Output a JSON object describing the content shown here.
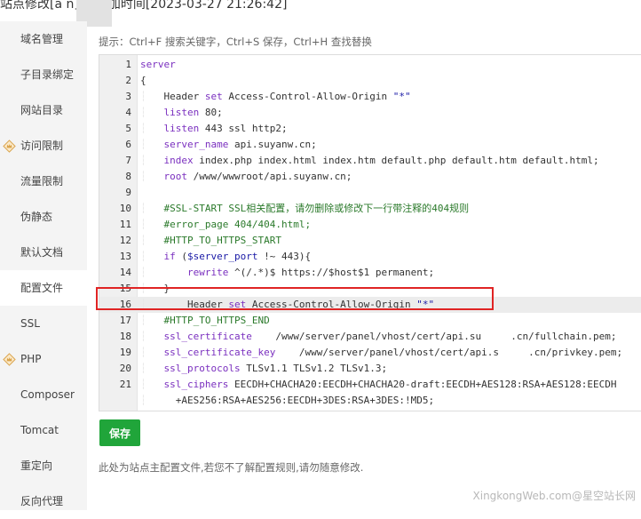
{
  "window": {
    "title": "站点修改[a  n] -- 添加时间[2023-03-27 21:26:42]"
  },
  "sidebar": {
    "items": [
      {
        "label": "域名管理",
        "vip": false,
        "active": false
      },
      {
        "label": "子目录绑定",
        "vip": false,
        "active": false
      },
      {
        "label": "网站目录",
        "vip": false,
        "active": false
      },
      {
        "label": "访问限制",
        "vip": true,
        "active": false
      },
      {
        "label": "流量限制",
        "vip": false,
        "active": false
      },
      {
        "label": "伪静态",
        "vip": false,
        "active": false
      },
      {
        "label": "默认文档",
        "vip": false,
        "active": false
      },
      {
        "label": "配置文件",
        "vip": false,
        "active": true
      },
      {
        "label": "SSL",
        "vip": false,
        "active": false
      },
      {
        "label": "PHP",
        "vip": true,
        "active": false
      },
      {
        "label": "Composer",
        "vip": false,
        "active": false
      },
      {
        "label": "Tomcat",
        "vip": false,
        "active": false
      },
      {
        "label": "重定向",
        "vip": false,
        "active": false
      },
      {
        "label": "反向代理",
        "vip": false,
        "active": false
      }
    ]
  },
  "hint": "提示：Ctrl+F 搜索关键字，Ctrl+S 保存，Ctrl+H 查找替换",
  "editor": {
    "active_line": 16,
    "lines": [
      {
        "n": "1",
        "text": "server"
      },
      {
        "n": "2",
        "text": "{"
      },
      {
        "n": "3",
        "text": "    Header set Access-Control-Allow-Origin \"*\""
      },
      {
        "n": "4",
        "text": "    listen 80;"
      },
      {
        "n": "5",
        "text": "    listen 443 ssl http2;"
      },
      {
        "n": "6",
        "text": "    server_name api.suyanw.cn;"
      },
      {
        "n": "7",
        "text": "    index index.php index.html index.htm default.php default.htm default.html;"
      },
      {
        "n": "8",
        "text": "    root /www/wwwroot/api.suyanw.cn;"
      },
      {
        "n": "9",
        "text": ""
      },
      {
        "n": "10",
        "text": "    #SSL-START SSL相关配置，请勿删除或修改下一行带注释的404规则"
      },
      {
        "n": "11",
        "text": "    #error_page 404/404.html;"
      },
      {
        "n": "12",
        "text": "    #HTTP_TO_HTTPS_START"
      },
      {
        "n": "13",
        "text": "    if ($server_port !~ 443){"
      },
      {
        "n": "14",
        "text": "        rewrite ^(/.*)$ https://$host$1 permanent;"
      },
      {
        "n": "15",
        "text": "    }"
      },
      {
        "n": "16",
        "text": "        Header set Access-Control-Allow-Origin \"*\""
      },
      {
        "n": "17",
        "text": "    #HTTP_TO_HTTPS_END"
      },
      {
        "n": "18",
        "text": "    ssl_certificate    /www/server/panel/vhost/cert/api.su     .cn/fullchain.pem;"
      },
      {
        "n": "19",
        "text": "    ssl_certificate_key    /www/server/panel/vhost/cert/api.s     .cn/privkey.pem;"
      },
      {
        "n": "20",
        "text": "    ssl_protocols TLSv1.1 TLSv1.2 TLSv1.3;"
      },
      {
        "n": "21",
        "text": "    ssl_ciphers EECDH+CHACHA20:EECDH+CHACHA20-draft:EECDH+AES128:RSA+AES128:EECDH"
      },
      {
        "n": "",
        "text": "      +AES256:RSA+AES256:EECDH+3DES:RSA+3DES:!MD5;"
      }
    ]
  },
  "save_button": "保存",
  "note": "此处为站点主配置文件,若您不了解配置规则,请勿随意修改.",
  "watermark": "XingkongWeb.com@星空站长网",
  "colors": {
    "accent": "#20a53a",
    "highlight_border": "#e02424",
    "sidebar_bg": "#f4f4f4"
  }
}
